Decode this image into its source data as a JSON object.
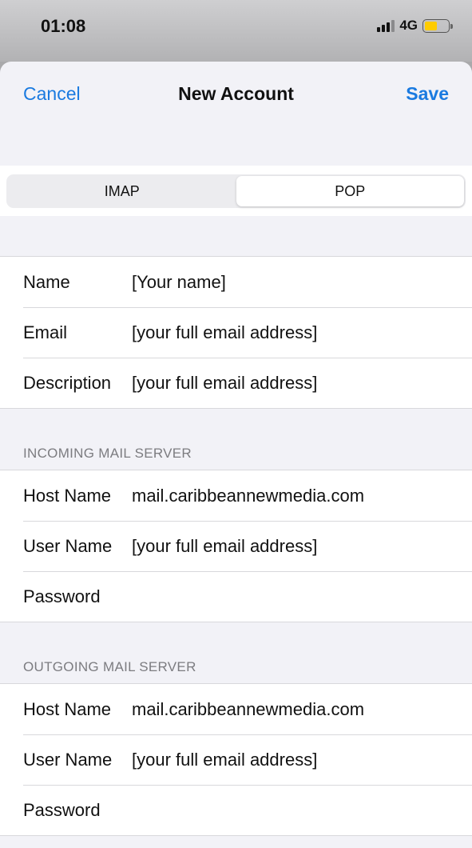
{
  "status_bar": {
    "time": "01:08",
    "network": "4G",
    "signal_bars_active": 3,
    "signal_bars_total": 4,
    "battery_level_fraction": 0.55,
    "battery_color": "#ffcc00"
  },
  "nav": {
    "cancel_label": "Cancel",
    "title": "New Account",
    "save_label": "Save",
    "accent_color": "#1a7ae0"
  },
  "segmented": {
    "options": [
      "IMAP",
      "POP"
    ],
    "selected": "POP"
  },
  "account": {
    "rows": [
      {
        "label": "Name",
        "value": "[Your name]"
      },
      {
        "label": "Email",
        "value": "[your full email address]"
      },
      {
        "label": "Description",
        "value": "[your full email address]"
      }
    ]
  },
  "incoming": {
    "header": "INCOMING MAIL SERVER",
    "rows": [
      {
        "label": "Host Name",
        "value": "mail.caribbeannewmedia.com"
      },
      {
        "label": "User Name",
        "value": "[your full email address]"
      },
      {
        "label": "Password",
        "value": ""
      }
    ]
  },
  "outgoing": {
    "header": "OUTGOING MAIL SERVER",
    "rows": [
      {
        "label": "Host Name",
        "value": "mail.caribbeannewmedia.com"
      },
      {
        "label": "User Name",
        "value": "[your full email address]"
      },
      {
        "label": "Password",
        "value": ""
      }
    ]
  }
}
